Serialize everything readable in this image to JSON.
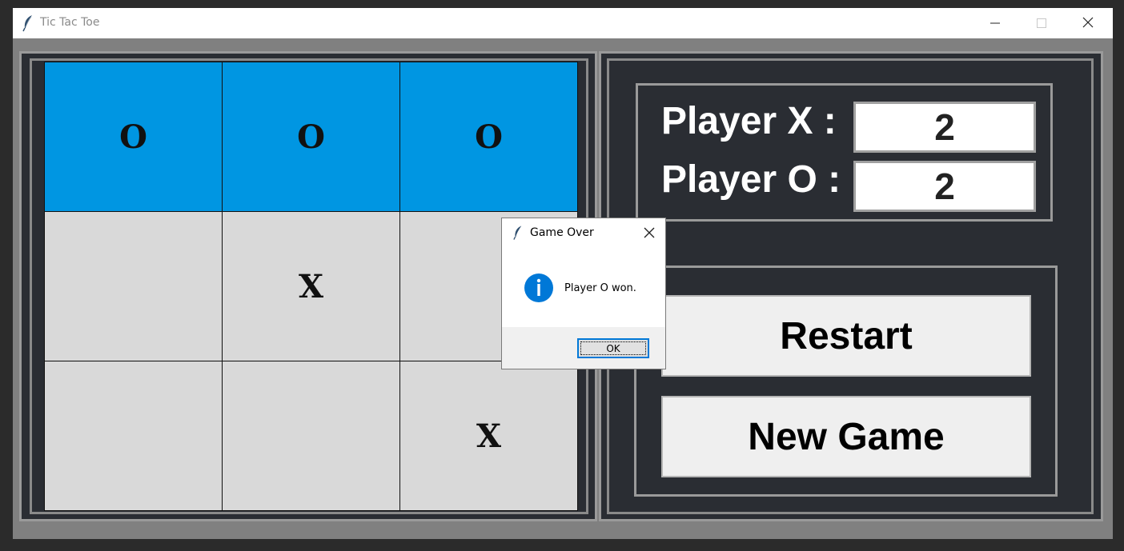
{
  "window": {
    "title": "Tic Tac Toe",
    "icon": "feather-icon",
    "controls": [
      "minimize-icon",
      "maximize-icon",
      "close-icon"
    ]
  },
  "board": {
    "cells": [
      "O",
      "O",
      "O",
      "",
      "X",
      "",
      "",
      "",
      "X"
    ],
    "winning_cells": [
      0,
      1,
      2
    ],
    "colors": {
      "win": "#0096e2",
      "plain": "#d9d9d9"
    }
  },
  "scoreboard": {
    "player_x_label": "Player X :",
    "player_x_score": "2",
    "player_o_label": "Player O :",
    "player_o_score": "2"
  },
  "controls": {
    "restart_label": "Restart",
    "new_game_label": "New Game"
  },
  "dialog": {
    "title": "Game Over",
    "message": "Player O won.",
    "ok_label": "OK",
    "icon": "info-icon"
  },
  "colors": {
    "panel_bg": "#2a2d33",
    "info_blue": "#0078d7"
  }
}
